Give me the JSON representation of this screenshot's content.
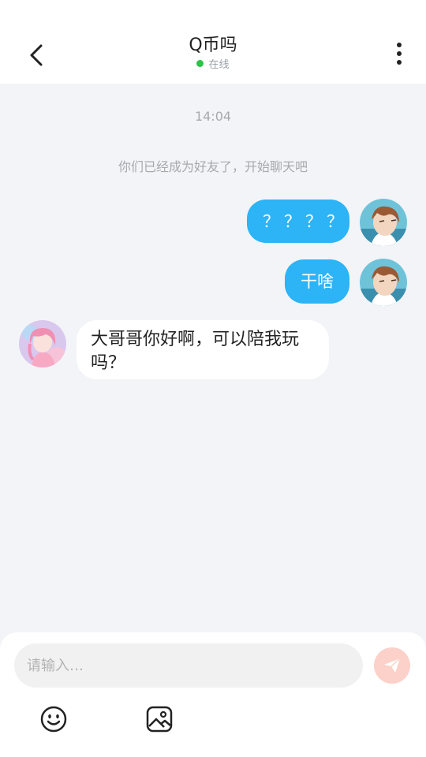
{
  "header": {
    "title": "Q币吗",
    "status": "在线",
    "back_icon": "chevron-left-icon",
    "more_icon": "more-vertical-icon"
  },
  "chat": {
    "timestamp": "14:04",
    "system_message": "你们已经成为好友了，开始聊天吧",
    "messages": [
      {
        "direction": "outgoing",
        "text": "？？？？"
      },
      {
        "direction": "outgoing",
        "text": "干啥"
      },
      {
        "direction": "incoming",
        "text": "大哥哥你好啊，可以陪我玩吗？"
      }
    ]
  },
  "composer": {
    "placeholder": "请输入…",
    "value": "",
    "send_icon": "send-icon",
    "emoji_icon": "smile-icon",
    "image_icon": "image-icon"
  },
  "colors": {
    "outgoing_bubble": "#2cb4f6",
    "online_dot": "#2ec24a",
    "send_button": "#fbd1c9"
  }
}
